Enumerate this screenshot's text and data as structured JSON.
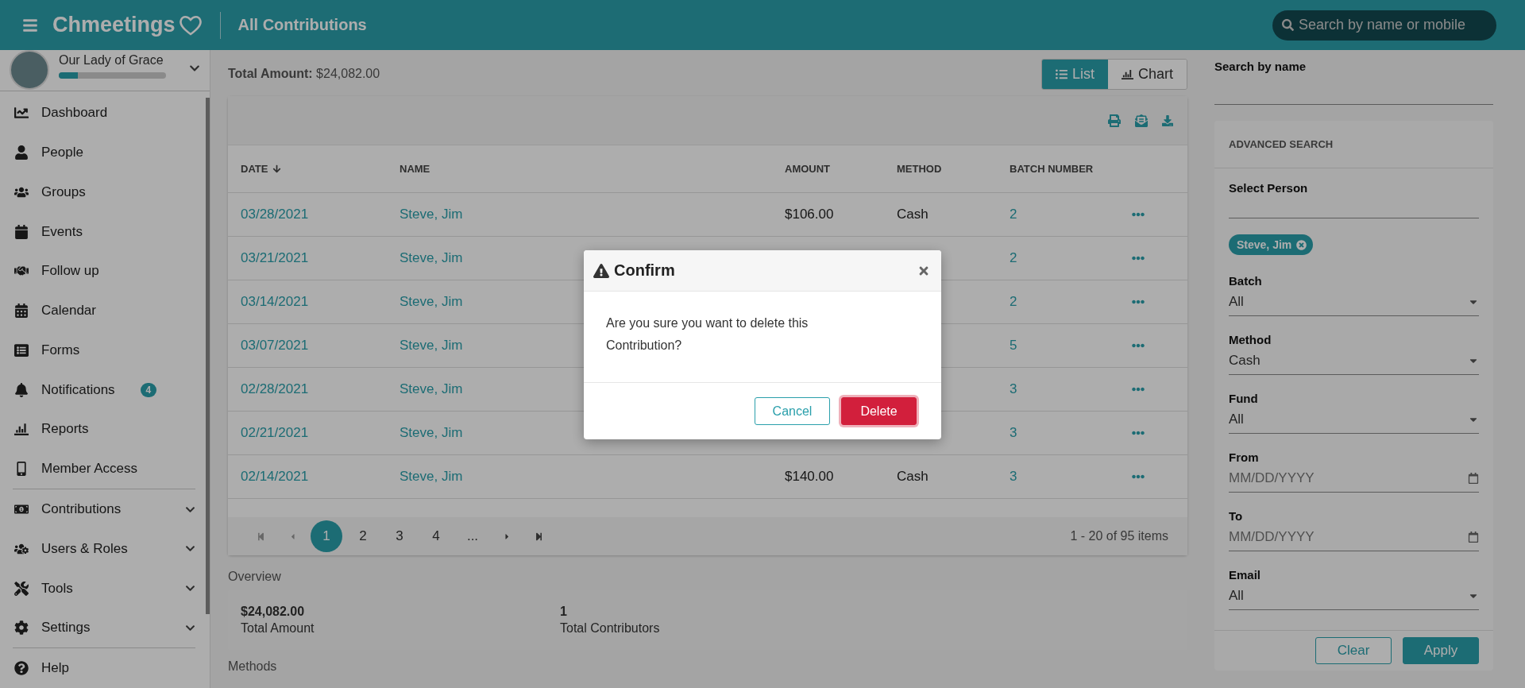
{
  "header": {
    "logo": "Chmeetings",
    "title": "All Contributions",
    "search_placeholder": "Search by name or mobile"
  },
  "sidebar": {
    "org_name": "Our Lady of Grace",
    "progress": {
      "level": 0.18
    },
    "items": [
      {
        "label": "Dashboard",
        "expandable": false,
        "divider_before": false
      },
      {
        "label": "People",
        "expandable": false,
        "divider_before": false
      },
      {
        "label": "Groups",
        "expandable": false,
        "divider_before": false
      },
      {
        "label": "Events",
        "expandable": false,
        "divider_before": false
      },
      {
        "label": "Follow up",
        "expandable": false,
        "divider_before": false
      },
      {
        "label": "Calendar",
        "expandable": false,
        "divider_before": false
      },
      {
        "label": "Forms",
        "expandable": false,
        "divider_before": false
      },
      {
        "label": "Notifications",
        "badge": "4",
        "expandable": false,
        "divider_before": false
      },
      {
        "label": "Reports",
        "expandable": false,
        "divider_before": false
      },
      {
        "label": "Member Access",
        "expandable": false,
        "divider_before": false
      },
      {
        "label": "Contributions",
        "expandable": true,
        "divider_before": true
      },
      {
        "label": "Users & Roles",
        "expandable": true,
        "divider_before": false
      },
      {
        "label": "Tools",
        "expandable": true,
        "divider_before": false
      },
      {
        "label": "Settings",
        "expandable": true,
        "divider_before": false
      },
      {
        "label": "Help",
        "expandable": false,
        "divider_before": true
      }
    ]
  },
  "summary": {
    "total_label": "Total Amount:",
    "total_value": "$24,082.00",
    "views": [
      {
        "label": "List",
        "selected": true
      },
      {
        "label": "Chart",
        "selected": false
      }
    ]
  },
  "table": {
    "columns": [
      {
        "label": "DATE",
        "sorted": true
      },
      {
        "label": "NAME",
        "sorted": false
      },
      {
        "label": "AMOUNT",
        "sorted": false
      },
      {
        "label": "METHOD",
        "sorted": false
      },
      {
        "label": "BATCH NUMBER",
        "sorted": false
      }
    ],
    "rows": [
      {
        "date": "03/28/2021",
        "name": "Steve, Jim",
        "amount": "$106.00",
        "method": "Cash",
        "batch": "2"
      },
      {
        "date": "03/21/2021",
        "name": "Steve, Jim",
        "batch": "2"
      },
      {
        "date": "03/14/2021",
        "name": "Steve, Jim",
        "batch": "2"
      },
      {
        "date": "03/07/2021",
        "name": "Steve, Jim",
        "batch": "5"
      },
      {
        "date": "02/28/2021",
        "name": "Steve, Jim",
        "batch": "3"
      },
      {
        "date": "02/21/2021",
        "name": "Steve, Jim",
        "batch": "3"
      },
      {
        "date": "02/14/2021",
        "name": "Steve, Jim",
        "amount": "$140.00",
        "method": "Cash",
        "batch": "3"
      }
    ],
    "pages": [
      {
        "label": "1",
        "selected": true
      },
      {
        "label": "2",
        "selected": false
      },
      {
        "label": "3",
        "selected": false
      },
      {
        "label": "4",
        "selected": false
      },
      {
        "label": "...",
        "selected": false
      }
    ],
    "items_info": "1 - 20 of 95 items"
  },
  "overview": {
    "title": "Overview",
    "stats": [
      {
        "value": "$24,082.00",
        "label": "Total Amount"
      },
      {
        "value": "1",
        "label": "Total Contributors"
      }
    ]
  },
  "methods_title": "Methods",
  "filters": {
    "search_label": "Search by name",
    "advanced_title": "ADVANCED SEARCH",
    "person_label": "Select Person",
    "person_chip": "Steve, Jim",
    "fields": [
      {
        "label": "Batch",
        "value": "All",
        "kind": "select"
      },
      {
        "label": "Method",
        "value": "Cash",
        "kind": "select"
      },
      {
        "label": "Fund",
        "value": "All",
        "kind": "select"
      },
      {
        "label": "From",
        "placeholder": "MM/DD/YYYY",
        "kind": "date"
      },
      {
        "label": "To",
        "placeholder": "MM/DD/YYYY",
        "kind": "date"
      },
      {
        "label": "Email",
        "value": "All",
        "kind": "select"
      }
    ],
    "clear": "Clear",
    "apply": "Apply"
  },
  "dialog": {
    "title": "Confirm",
    "message": "Are you sure you want to delete this Contribution?",
    "cancel": "Cancel",
    "confirm": "Delete"
  }
}
